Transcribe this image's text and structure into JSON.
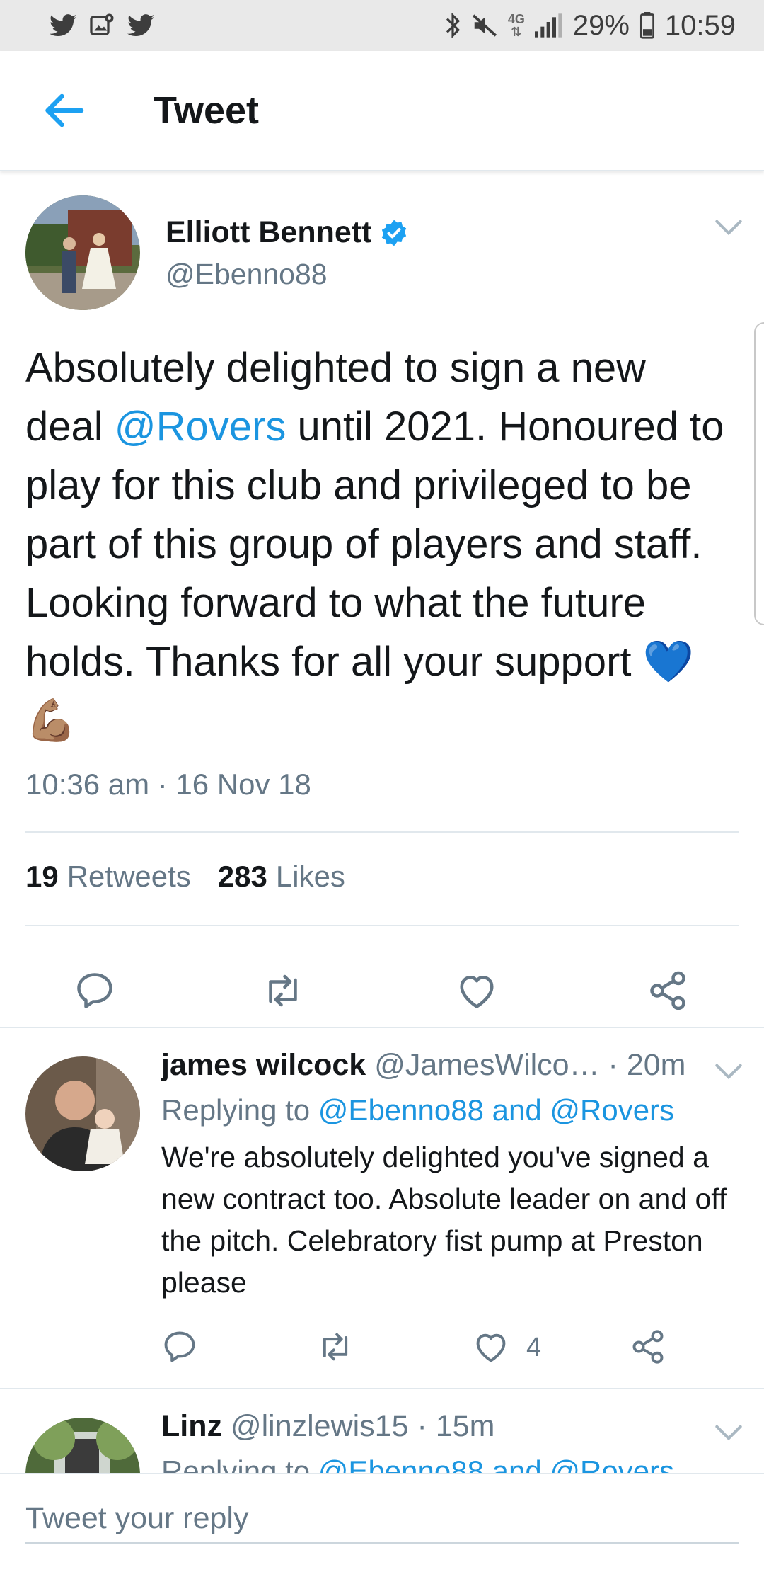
{
  "status_bar": {
    "left_icons": [
      "twitter-icon",
      "gallery-notification-icon",
      "twitter-icon"
    ],
    "right_icons": [
      "bluetooth-icon",
      "mute-icon",
      "network-4g-icon",
      "signal-icon",
      "battery-icon"
    ],
    "network": "4G",
    "battery": "29%",
    "time": "10:59"
  },
  "app_bar": {
    "title": "Tweet"
  },
  "main_tweet": {
    "author": "Elliott Bennett",
    "verified": true,
    "handle": "@Ebenno88",
    "text_before": "Absolutely delighted to sign a new deal ",
    "mention": "@Rovers",
    "text_after": " until 2021. Honoured to play for this club and privileged to be part of this group of players and staff. Looking forward to what the future holds. Thanks for all your support 💙💪🏽",
    "timestamp": "10:36 am · 16 Nov 18",
    "retweets_count": "19",
    "retweets_label": "Retweets",
    "likes_count": "283",
    "likes_label": "Likes"
  },
  "replies": [
    {
      "name": "james wilcock",
      "handle": "@JamesWilco…",
      "time": "· 20m",
      "replying_label": "Replying to ",
      "replying_to": "@Ebenno88 and @Rovers",
      "text": "We're absolutely delighted you've signed a new contract too. Absolute leader on and off the pitch. Celebratory fist pump at Preston please",
      "likes": "4"
    },
    {
      "name": "Linz",
      "handle": "@linzlewis15",
      "time": "· 15m",
      "replying_label": "Replying to ",
      "replying_to": "@Ebenno88 and @Rovers"
    }
  ],
  "compose": {
    "placeholder": "Tweet your reply"
  },
  "colors": {
    "accent": "#1da1f2",
    "link": "#1b95e0",
    "secondary_text": "#657786",
    "primary_text": "#14171a",
    "divider": "#e1e8ed"
  }
}
